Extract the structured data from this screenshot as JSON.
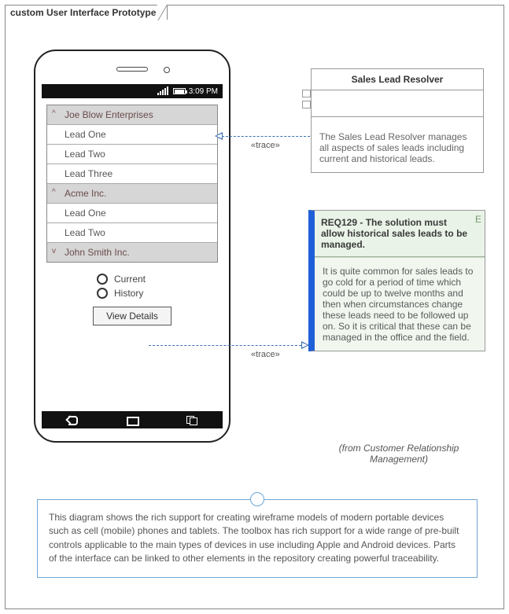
{
  "frame": {
    "title": "custom User Interface Prototype"
  },
  "statusbar": {
    "time": "3:09 PM"
  },
  "list": {
    "groups": [
      {
        "label": "Joe Blow Enterprises",
        "caret": "^",
        "items": [
          "Lead One",
          "Lead Two",
          "Lead Three"
        ]
      },
      {
        "label": "Acme Inc.",
        "caret": "^",
        "items": [
          "Lead One",
          "Lead Two"
        ]
      },
      {
        "label": "John Smith Inc.",
        "caret": "v",
        "items": []
      }
    ]
  },
  "radios": {
    "current": "Current",
    "history": "History"
  },
  "button": {
    "view_details": "View Details"
  },
  "sales_lead": {
    "title": "Sales Lead Resolver",
    "desc": "The Sales Lead Resolver manages all aspects of sales leads including current and historical leads."
  },
  "req": {
    "badge": "E",
    "title": "REQ129 - The solution must allow historical sales leads to be managed.",
    "body": "It is quite common for sales leads to go cold for a period of time which could be up to twelve months and then when circumstances change these leads need to be followed up on. So it is critical that these can be managed in the office and the field."
  },
  "from_label": "(from Customer Relationship Management)",
  "trace_label": "«trace»",
  "note": {
    "text": "This diagram shows the rich support for creating wireframe models of modern portable devices such as cell (mobile) phones and tablets. The toolbox has rich support for a wide range of pre-built controls applicable to the main types of devices in use including Apple and Android devices. Parts of the interface can be linked to other elements in the repository creating powerful traceability."
  }
}
